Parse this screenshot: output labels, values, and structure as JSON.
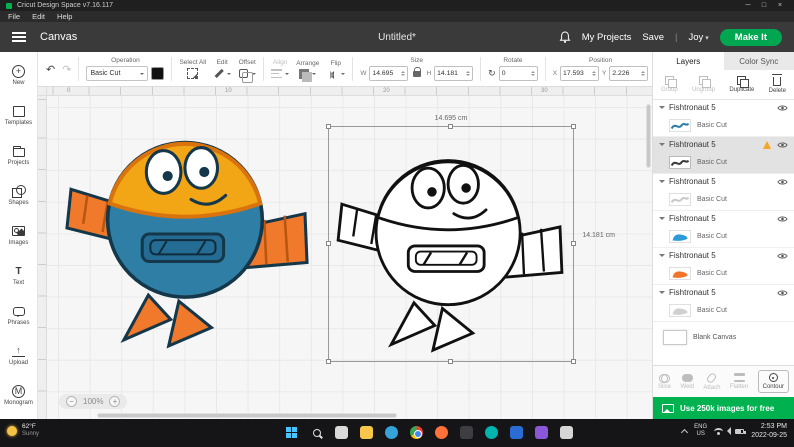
{
  "window": {
    "title": "Cricut Design Space v7.16.117",
    "menus": [
      "File",
      "Edit",
      "Help"
    ],
    "controls": {
      "minimize": "─",
      "maximize": "□",
      "close": "×"
    }
  },
  "icons": {
    "undo": "↶",
    "redo": "↷",
    "rotate": "↻",
    "plus": "+",
    "up_arrow": "↑",
    "text_glyph": "T",
    "monogram_glyph": "M"
  },
  "header": {
    "canvas": "Canvas",
    "title": "Untitled*",
    "my_projects": "My Projects",
    "save": "Save",
    "divider": "|",
    "user": "Joy",
    "make_it": "Make It"
  },
  "toolbar": {
    "operation_label": "Operation",
    "operation_value": "Basic Cut",
    "select_all": "Select All",
    "edit": "Edit",
    "offset": "Offset",
    "align": "Align",
    "arrange": "Arrange",
    "flip": "Flip",
    "size_label": "Size",
    "w_label": "W",
    "w_value": "14.695",
    "h_label": "H",
    "h_value": "14.181",
    "rotate_label": "Rotate",
    "rotate_value": "0",
    "position_label": "Position",
    "x_label": "X",
    "x_value": "17.593",
    "y_label": "Y",
    "y_value": "2.226"
  },
  "sidebar": {
    "items": [
      {
        "label": "New"
      },
      {
        "label": "Templates"
      },
      {
        "label": "Projects"
      },
      {
        "label": "Shapes"
      },
      {
        "label": "Images"
      },
      {
        "label": "Text"
      },
      {
        "label": "Phrases"
      },
      {
        "label": "Upload"
      },
      {
        "label": "Monogram"
      }
    ]
  },
  "canvas": {
    "ruler_h": [
      "0",
      "10",
      "20",
      "30"
    ],
    "selection": {
      "width_label": "14.695 cm",
      "height_label": "14.181 cm"
    },
    "zoom": {
      "minus": "−",
      "value": "100%",
      "plus": "+"
    }
  },
  "right_panel": {
    "tabs": {
      "layers": "Layers",
      "color_sync": "Color Sync"
    },
    "actions": {
      "group": "Group",
      "ungroup": "Ungroup",
      "duplicate": "Duplicate",
      "delete": "Delete"
    },
    "layers": [
      {
        "name": "Fishtronaut 5",
        "type": "Basic Cut",
        "thumb_color": "#2E7EA5"
      },
      {
        "name": "Fishtronaut 5",
        "type": "Basic Cut",
        "thumb_color": "#3A3A3A"
      },
      {
        "name": "Fishtronaut 5",
        "type": "Basic Cut",
        "thumb_color": "#C9C9C9"
      },
      {
        "name": "Fishtronaut 5",
        "type": "Basic Cut",
        "thumb_color": "#2E9BD6"
      },
      {
        "name": "Fishtronaut 5",
        "type": "Basic Cut",
        "thumb_color": "#F0752B"
      },
      {
        "name": "Fishtronaut 5",
        "type": "Basic Cut",
        "thumb_color": "#D0D0D0"
      }
    ],
    "blank_canvas": "Blank Canvas",
    "bottom_actions": {
      "slice": "Slice",
      "weld": "Weld",
      "attach": "Attach",
      "flatten": "Flatten",
      "contour": "Contour"
    },
    "banner": "Use 250k images for free"
  },
  "taskbar": {
    "weather": {
      "temp": "62°F",
      "condition": "Sunny"
    },
    "apps": [
      {
        "name": "start",
        "color": "#4CC2FF"
      },
      {
        "name": "search",
        "color": "#E8E8E8"
      },
      {
        "name": "task-view",
        "color": "#D9D9D9"
      },
      {
        "name": "file-explorer",
        "color": "#F8C64A"
      },
      {
        "name": "edge",
        "color": "#35A3DA"
      },
      {
        "name": "chrome",
        "color": "#E8453C"
      },
      {
        "name": "firefox",
        "color": "#FF7139"
      },
      {
        "name": "app-8",
        "color": "#3E3E42"
      },
      {
        "name": "app-9",
        "color": "#00B5AD"
      },
      {
        "name": "app-10",
        "color": "#2B6BD4"
      },
      {
        "name": "app-11",
        "color": "#8A57D9"
      },
      {
        "name": "app-12",
        "color": "#D6D6D6"
      }
    ],
    "tray": {
      "lang1": "ENG",
      "lang2": "US",
      "time": "2:53 PM",
      "date": "2022-09-25"
    }
  },
  "palette": {
    "make_it_green": "#00A650",
    "banner_green": "#00B14F",
    "character_blue": "#2E7EA5",
    "character_yellow": "#F2A515",
    "character_orange": "#F0792B",
    "outline_black": "#111111",
    "selection_border": "#999999"
  }
}
